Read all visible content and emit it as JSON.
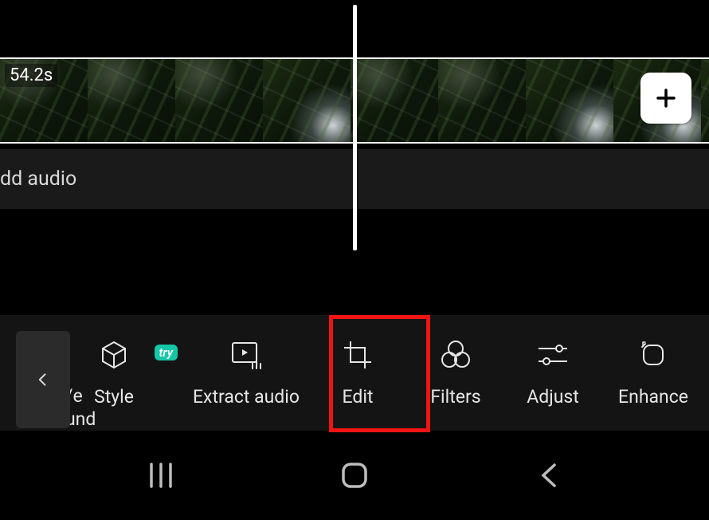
{
  "timeline": {
    "clip_time_label": "54.2s",
    "add_audio_label": "dd audio"
  },
  "toolbar": {
    "back_icon": "chevron-left",
    "partial_item_label": "/e\nund",
    "items": [
      {
        "id": "style",
        "label": "Style",
        "icon": "cube-icon",
        "badge": "try"
      },
      {
        "id": "extract-audio",
        "label": "Extract audio",
        "icon": "extract-icon",
        "badge": null
      },
      {
        "id": "edit",
        "label": "Edit",
        "icon": "crop-icon",
        "badge": null
      },
      {
        "id": "filters",
        "label": "Filters",
        "icon": "filters-icon",
        "badge": null
      },
      {
        "id": "adjust",
        "label": "Adjust",
        "icon": "sliders-icon",
        "badge": null
      },
      {
        "id": "enhance",
        "label": "Enhance",
        "icon": "enhance-icon",
        "badge": null
      }
    ],
    "style_badge": "try",
    "labels": {
      "style": "Style",
      "extract_audio": "Extract audio",
      "edit": "Edit",
      "filters": "Filters",
      "adjust": "Adjust",
      "enhance": "Enhance"
    }
  },
  "highlight": {
    "target_tool_id": "edit"
  },
  "navbar": {
    "recents": "recents",
    "home": "home",
    "back": "back"
  }
}
